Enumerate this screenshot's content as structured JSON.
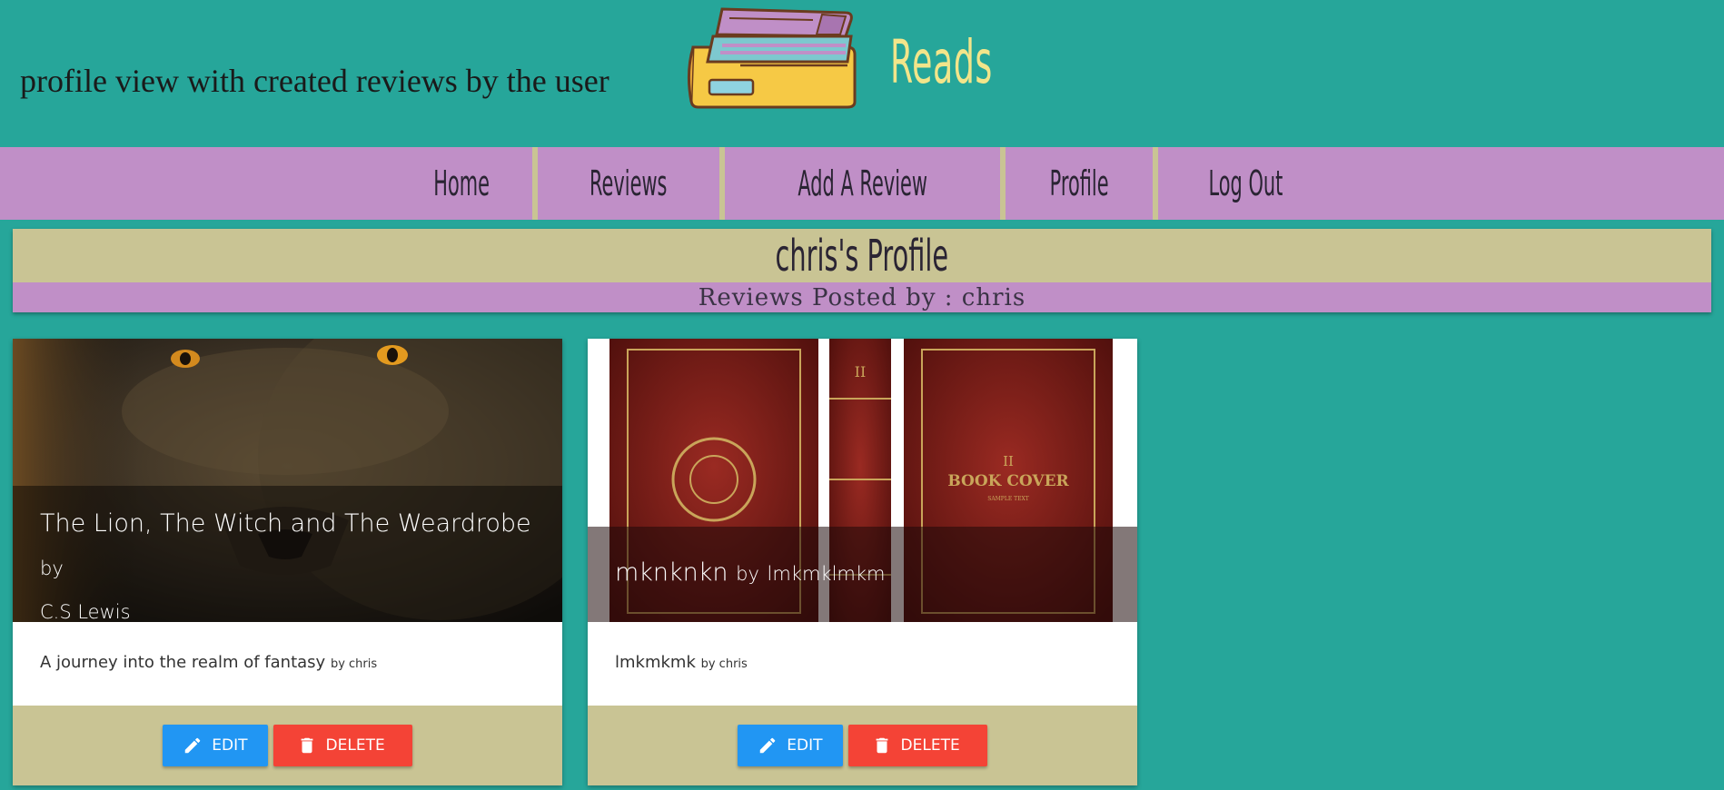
{
  "header": {
    "caption": "profile view with created reviews by the user",
    "brand": "Reads"
  },
  "nav": {
    "items": [
      "Home",
      "Reviews",
      "Add A Review",
      "Profile",
      "Log Out"
    ]
  },
  "profile": {
    "title": "chris's Profile",
    "subtitle": "Reviews Posted by : chris"
  },
  "reviews": [
    {
      "title": "The Lion, The Witch and The Weardrobe",
      "by": "by",
      "author": "C.S Lewis",
      "description": "A journey into the realm of fantasy",
      "posted_by": "by chris",
      "edit_label": "EDIT",
      "delete_label": "DELETE"
    },
    {
      "title": "mknknkn",
      "by": "by",
      "author": "lmkmklmkm",
      "description": "lmkmkmk",
      "posted_by": "by chris",
      "edit_label": "EDIT",
      "delete_label": "DELETE"
    }
  ],
  "colors": {
    "background": "#26a69a",
    "nav": "#c08fc7",
    "khaki": "#c9c494",
    "brand": "#f2e58a",
    "edit": "#2196f3",
    "delete": "#f44336"
  },
  "icons": [
    "books-logo-icon",
    "pencil-icon",
    "trash-icon"
  ]
}
